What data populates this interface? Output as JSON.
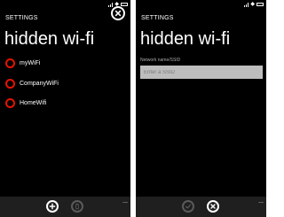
{
  "screens": [
    {
      "id": "network-list",
      "header": "SETTINGS",
      "title": "hidden wi-fi",
      "networks": [
        "myWiFi",
        "CompanyWiFi",
        "HomeWifi"
      ],
      "appbar": {
        "buttons": [
          "add-icon",
          "delete-icon"
        ],
        "more": "..."
      }
    },
    {
      "id": "add-network",
      "header": "SETTINGS",
      "title": "hidden wi-fi",
      "field_label": "Network name/SSID",
      "ssid_value": "",
      "ssid_placeholder": "Enter a SSID",
      "appbar": {
        "buttons": [
          "check-icon",
          "cancel-icon"
        ],
        "more": "..."
      }
    }
  ],
  "colors": {
    "background": "#000000",
    "accent": "#e51400",
    "appbar": "#1f1f1f",
    "input": "#bdbdbd",
    "disabled": "#5a5a5a"
  }
}
